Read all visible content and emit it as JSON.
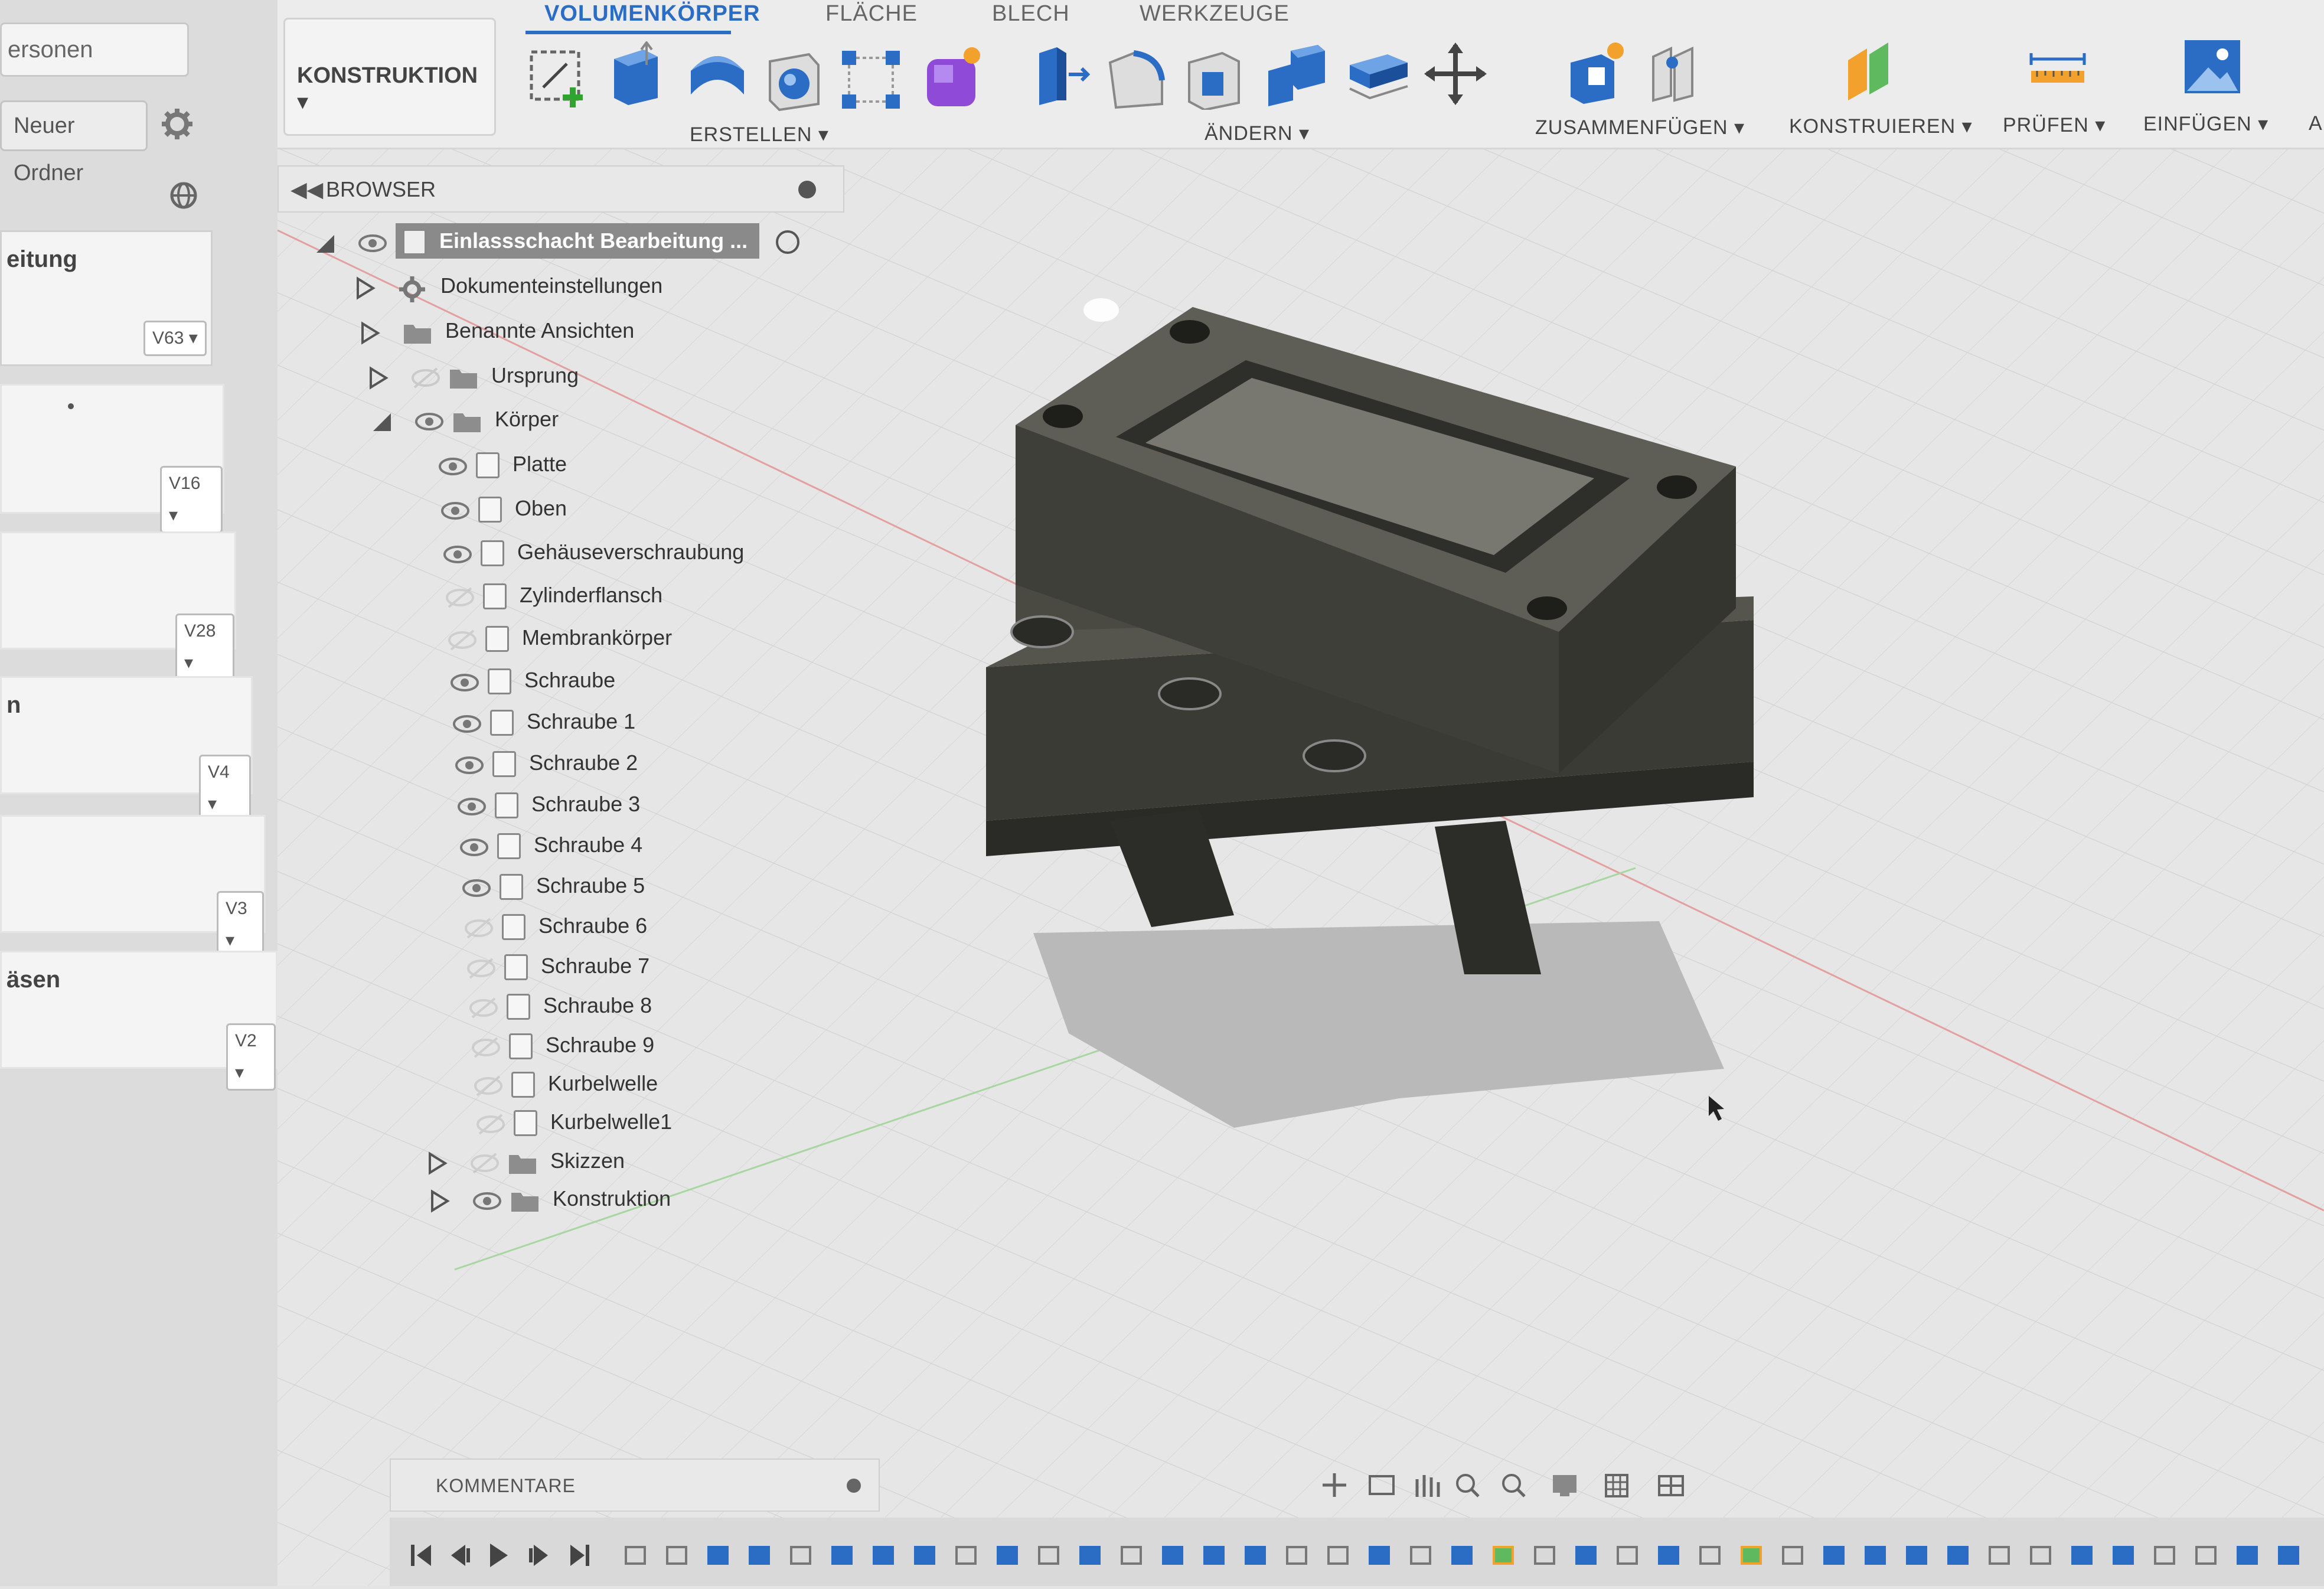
{
  "left_panel": {
    "search_value": "ersonen",
    "new_folder_label": "Neuer Ordner",
    "items": [
      {
        "title": "eitung",
        "version": "V63 ▾"
      },
      {
        "title": "",
        "version": "V16 ▾"
      },
      {
        "title": "",
        "version": "V28 ▾"
      },
      {
        "title": "n",
        "version": "V4 ▾"
      },
      {
        "title": "",
        "version": "V3 ▾"
      },
      {
        "title": "äsen",
        "version": "V2 ▾"
      }
    ]
  },
  "toolbar": {
    "tabs": [
      "VOLUMENKÖRPER",
      "FLÄCHE",
      "BLECH",
      "WERKZEUGE"
    ],
    "active_tab": "VOLUMENKÖRPER",
    "workspace_label": "KONSTRUKTION ▾",
    "groups": {
      "erstellen": "ERSTELLEN ▾",
      "aendern": "ÄNDERN ▾",
      "zusammenfuegen": "ZUSAMMENFÜGEN ▾",
      "konstruieren": "KONSTRUIEREN ▾",
      "pruefen": "PRÜFEN ▾",
      "einfuegen": "EINFÜGEN ▾",
      "more": "A"
    },
    "accent": "#2b6cc4"
  },
  "browser": {
    "title": "BROWSER",
    "root": "Einlassschacht Bearbeitung ...",
    "folders": {
      "doc_settings": "Dokumenteinstellungen",
      "named_views": "Benannte Ansichten",
      "origin": "Ursprung",
      "bodies": "Körper",
      "sketches": "Skizzen",
      "construction": "Konstruktion"
    },
    "bodies": [
      {
        "name": "Platte",
        "visible": true
      },
      {
        "name": "Oben",
        "visible": true
      },
      {
        "name": "Gehäuseverschraubung",
        "visible": true
      },
      {
        "name": "Zylinderflansch",
        "visible": false
      },
      {
        "name": "Membrankörper",
        "visible": false
      },
      {
        "name": "Schraube",
        "visible": true
      },
      {
        "name": "Schraube 1",
        "visible": true
      },
      {
        "name": "Schraube 2",
        "visible": true
      },
      {
        "name": "Schraube 3",
        "visible": true
      },
      {
        "name": "Schraube 4",
        "visible": true
      },
      {
        "name": "Schraube 5",
        "visible": true
      },
      {
        "name": "Schraube 6",
        "visible": false
      },
      {
        "name": "Schraube 7",
        "visible": false
      },
      {
        "name": "Schraube 8",
        "visible": false
      },
      {
        "name": "Schraube 9",
        "visible": false
      },
      {
        "name": "Kurbelwelle",
        "visible": false
      },
      {
        "name": "Kurbelwelle1",
        "visible": false
      }
    ]
  },
  "comments": {
    "label": "KOMMENTARE"
  }
}
